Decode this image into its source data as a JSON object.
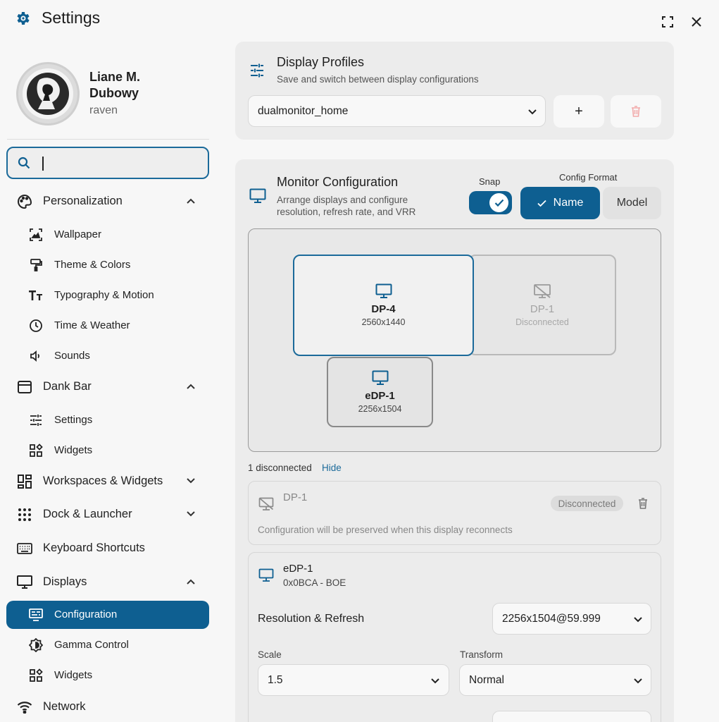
{
  "window": {
    "title": "Settings",
    "icons": {
      "app": "gear-icon",
      "maximize": "maximize-icon",
      "close": "close-icon"
    }
  },
  "user": {
    "name": "Liane M. Dubowy",
    "handle": "raven"
  },
  "search": {
    "placeholder": "",
    "value": ""
  },
  "sidebar": {
    "items": [
      {
        "label": "Personalization",
        "icon": "palette-icon",
        "expanded": true
      },
      {
        "label": "Wallpaper",
        "icon": "wallpaper-icon"
      },
      {
        "label": "Theme & Colors",
        "icon": "paint-roller-icon"
      },
      {
        "label": "Typography & Motion",
        "icon": "text-size-icon"
      },
      {
        "label": "Time & Weather",
        "icon": "clock-icon"
      },
      {
        "label": "Sounds",
        "icon": "speaker-icon"
      },
      {
        "label": "Dank Bar",
        "icon": "toolbar-icon",
        "expanded": true
      },
      {
        "label": "Settings",
        "icon": "tune-icon"
      },
      {
        "label": "Widgets",
        "icon": "widgets-icon"
      },
      {
        "label": "Workspaces & Widgets",
        "icon": "dashboard-icon",
        "expanded": false
      },
      {
        "label": "Dock & Launcher",
        "icon": "apps-grid-icon",
        "expanded": false
      },
      {
        "label": "Keyboard Shortcuts",
        "icon": "keyboard-icon"
      },
      {
        "label": "Displays",
        "icon": "monitor-icon",
        "expanded": true
      },
      {
        "label": "Configuration",
        "icon": "display-settings-icon",
        "active": true
      },
      {
        "label": "Gamma Control",
        "icon": "brightness-icon"
      },
      {
        "label": "Widgets",
        "icon": "widgets-icon"
      },
      {
        "label": "Network",
        "icon": "wifi-icon"
      }
    ]
  },
  "profiles": {
    "title": "Display Profiles",
    "subtitle": "Save and switch between display configurations",
    "selected": "dualmonitor_home",
    "add_label": "+",
    "icons": {
      "header": "tune-icon",
      "delete": "trash-icon"
    }
  },
  "monitor_config": {
    "title": "Monitor Configuration",
    "subtitle_line1": "Arrange displays and configure",
    "subtitle_line2": "resolution, refresh rate, and VRR",
    "snap_label": "Snap",
    "snap_on": true,
    "format_label": "Config Format",
    "format_options": [
      "Name",
      "Model"
    ],
    "format_selected": "Name"
  },
  "monitors": [
    {
      "name": "DP-4",
      "detail": "2560x1440",
      "connected": true,
      "selected": true
    },
    {
      "name": "DP-1",
      "detail": "Disconnected",
      "connected": false
    },
    {
      "name": "eDP-1",
      "detail": "2256x1504",
      "connected": true
    }
  ],
  "disconnected_summary": {
    "count_text": "1 disconnected",
    "hide_label": "Hide"
  },
  "dp1_panel": {
    "name": "DP-1",
    "badge": "Disconnected",
    "note": "Configuration will be preserved when this display reconnects"
  },
  "edp_panel": {
    "name": "eDP-1",
    "model": "0x0BCA - BOE",
    "resolution_label": "Resolution & Refresh",
    "resolution_value": "2256x1504@59.999",
    "scale_label": "Scale",
    "scale_value": "1.5",
    "transform_label": "Transform",
    "transform_value": "Normal"
  },
  "colors": {
    "accent": "#0e5f91",
    "background": "#f7f7f7",
    "card": "#ececec",
    "danger": "#f2a9a9"
  }
}
